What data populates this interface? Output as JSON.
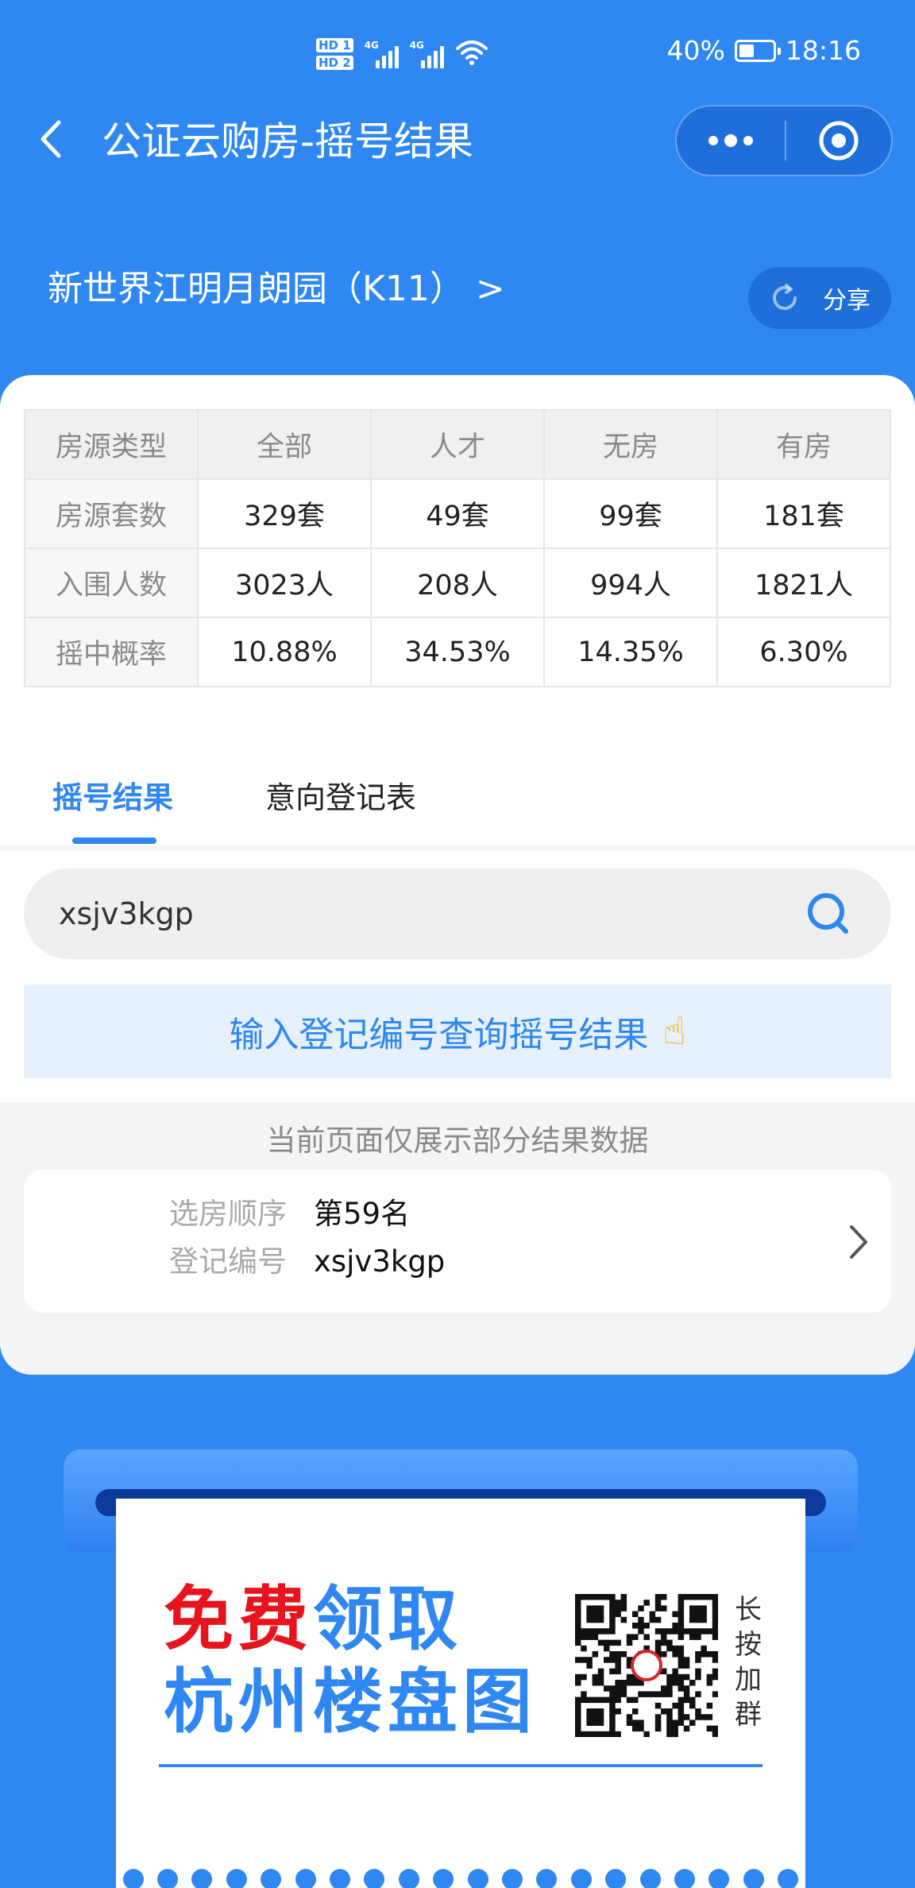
{
  "status_bar": {
    "hd1": "HD 1",
    "hd2": "HD 2",
    "net1": "4G",
    "net2": "4G",
    "battery_percent": "40%",
    "battery_level": 0.4,
    "time": "18:16"
  },
  "nav": {
    "title": "公证云购房-摇号结果"
  },
  "project": {
    "name": "新世界江明月朗园（K11） >",
    "share_label": "分享"
  },
  "stats": {
    "headers": [
      "房源类型",
      "全部",
      "人才",
      "无房",
      "有房"
    ],
    "rows": [
      [
        "房源套数",
        "329套",
        "49套",
        "99套",
        "181套"
      ],
      [
        "入围人数",
        "3023人",
        "208人",
        "994人",
        "1821人"
      ],
      [
        "摇中概率",
        "10.88%",
        "34.53%",
        "14.35%",
        "6.30%"
      ]
    ]
  },
  "tabs": {
    "active": "摇号结果",
    "second": "意向登记表"
  },
  "search": {
    "value": "xsjv3kgp"
  },
  "hint": {
    "text": "输入登记编号查询摇号结果",
    "emoji": "☝"
  },
  "results": {
    "note": "当前页面仅展示部分结果数据",
    "item": {
      "order_label": "选房顺序",
      "order_value": "第59名",
      "reg_label": "登记编号",
      "reg_value": "xsjv3kgp"
    }
  },
  "promo": {
    "line1_red": "免费",
    "line1_blue": "领取",
    "line2": "杭州楼盘图",
    "side": [
      "长",
      "按",
      "加",
      "群"
    ]
  },
  "colors": {
    "brand_blue": "#2f87f2",
    "promo_red": "#e8141d"
  }
}
